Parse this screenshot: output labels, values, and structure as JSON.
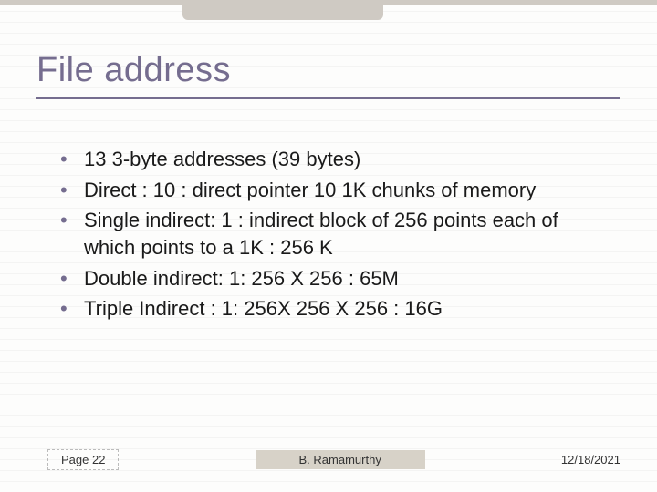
{
  "title": "File address",
  "bullets": [
    "13 3-byte addresses (39 bytes)",
    "Direct : 10  : direct pointer 10 1K chunks of memory",
    "Single indirect: 1  : indirect block of 256 points each of which points to a 1K : 256 K",
    "Double indirect: 1: 256 X 256 : 65M",
    "Triple Indirect : 1: 256X 256 X 256 : 16G"
  ],
  "footer": {
    "page": "Page 22",
    "author": "B. Ramamurthy",
    "date": "12/18/2021"
  }
}
